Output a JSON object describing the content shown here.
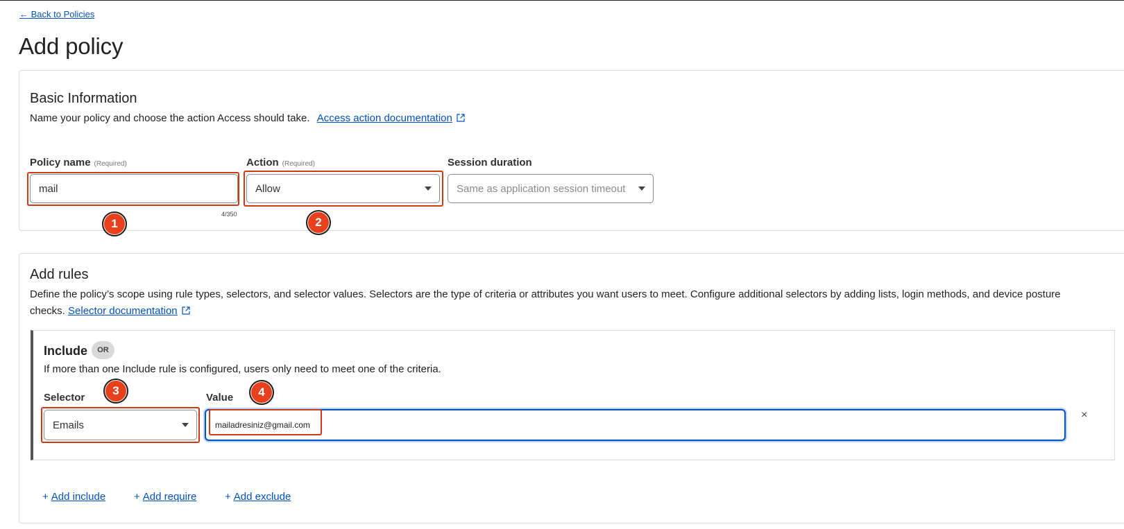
{
  "nav": {
    "back_link": "← Back to Policies"
  },
  "page": {
    "title": "Add policy"
  },
  "basic_info": {
    "title": "Basic Information",
    "description": "Name your policy and choose the action Access should take.",
    "doc_link": "Access action documentation",
    "policy_name": {
      "label": "Policy name",
      "required": "(Required)",
      "value": "mail",
      "counter": "4/350"
    },
    "action": {
      "label": "Action",
      "required": "(Required)",
      "value": "Allow"
    },
    "session_duration": {
      "label": "Session duration",
      "placeholder": "Same as application session timeout"
    }
  },
  "rules": {
    "title": "Add rules",
    "description": "Define the policy’s scope using rule types, selectors, and selector values. Selectors are the type of criteria or attributes you want users to meet. Configure additional selectors by adding lists, login methods, and device posture checks.",
    "doc_link": "Selector documentation",
    "include": {
      "title": "Include",
      "or_badge": "OR",
      "description": "If more than one Include rule is configured, users only need to meet one of the criteria.",
      "selector_label": "Selector",
      "selector_value": "Emails",
      "value_label": "Value",
      "value": "mailadresiniz@gmail.com",
      "remove": "×"
    },
    "actions": {
      "add_include": "Add include",
      "add_require": "Add require",
      "add_exclude": "Add exclude",
      "plus": "+"
    }
  },
  "annotations": [
    "1",
    "2",
    "3",
    "4"
  ],
  "colors": {
    "link": "#0051c3",
    "annotation": "#e8401c",
    "highlight_border": "#cf3a14",
    "focus_border": "#0051c3"
  }
}
